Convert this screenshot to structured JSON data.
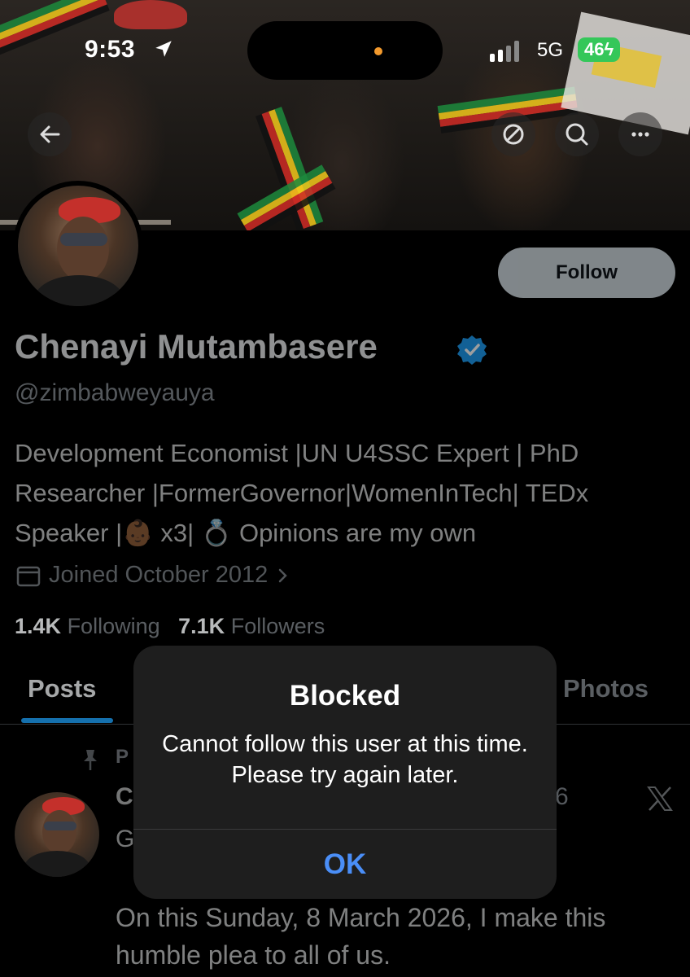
{
  "status_bar": {
    "time": "9:53",
    "network": "5G",
    "battery": "46"
  },
  "profile": {
    "name": "Chenayi Mutambasere",
    "handle": "@zimbabweyauya",
    "bio": "Development Economist |UN U4SSC Expert | PhD Researcher |FormerGovernor|WomenInTech| TEDx Speaker |👶🏾 x3| 💍 Opinions are my own",
    "joined": "Joined October 2012",
    "following_count": "1.4K",
    "following_label": "Following",
    "followers_count": "7.1K",
    "followers_label": "Followers",
    "follow_button": "Follow"
  },
  "tabs": {
    "posts": "Posts",
    "photos": "Photos"
  },
  "pinned_post": {
    "pinned_fragment": "P",
    "author_fragment": "C",
    "date_fragment": "6",
    "first_line_fragment": "G",
    "text": "On this Sunday, 8 March 2026, I make this humble plea to all of us."
  },
  "alert": {
    "title": "Blocked",
    "message": "Cannot follow this user at this time. Please try again later.",
    "ok": "OK"
  },
  "colors": {
    "accent": "#1d9bf0",
    "alert_button": "#4a8ef7",
    "battery": "#34c759"
  },
  "icons": [
    "location-arrow-icon",
    "signal-icon",
    "back-icon",
    "mute-icon",
    "search-icon",
    "more-icon",
    "verified-badge-icon",
    "calendar-icon",
    "chevron-right-icon",
    "pin-icon",
    "x-logo-icon"
  ]
}
